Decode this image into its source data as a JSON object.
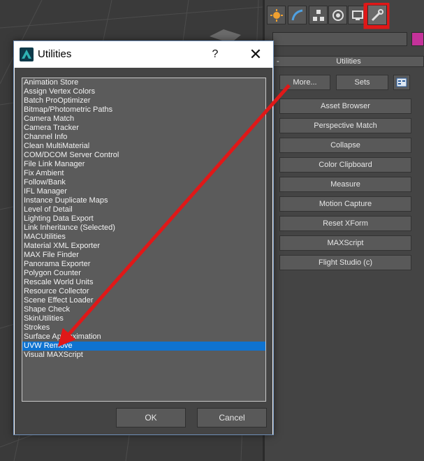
{
  "command_panel": {
    "tabs": [
      {
        "icon": "create-icon"
      },
      {
        "icon": "modify-icon"
      },
      {
        "icon": "hierarchy-icon"
      },
      {
        "icon": "motion-icon"
      },
      {
        "icon": "display-icon"
      },
      {
        "icon": "utilities-icon",
        "active": true
      }
    ],
    "swatch_color": "#c4329a",
    "rollout_title": "Utilities",
    "collapse_mark": "-",
    "more_label": "More...",
    "sets_label": "Sets",
    "buttons": [
      "Asset Browser",
      "Perspective Match",
      "Collapse",
      "Color Clipboard",
      "Measure",
      "Motion Capture",
      "Reset XForm",
      "MAXScript",
      "Flight Studio (c)"
    ]
  },
  "dialog": {
    "title": "Utilities",
    "help": "?",
    "close": "✕",
    "items": [
      "Animation Store",
      "Assign Vertex Colors",
      "Batch ProOptimizer",
      "Bitmap/Photometric Paths",
      "Camera Match",
      "Camera Tracker",
      "Channel Info",
      "Clean MultiMaterial",
      "COM/DCOM Server Control",
      "File Link Manager",
      "Fix Ambient",
      "Follow/Bank",
      "IFL Manager",
      "Instance Duplicate Maps",
      "Level of Detail",
      "Lighting Data Export",
      "Link Inheritance (Selected)",
      "MACUtilities",
      "Material XML Exporter",
      "MAX File Finder",
      "Panorama Exporter",
      "Polygon Counter",
      "Rescale World Units",
      "Resource Collector",
      "Scene Effect Loader",
      "Shape Check",
      "SkinUtilities",
      "Strokes",
      "Surface Approximation",
      "UVW Remove",
      "Visual MAXScript"
    ],
    "selected_index": 29,
    "ok_label": "OK",
    "cancel_label": "Cancel"
  },
  "colors": {
    "selection": "#0f73d0",
    "annotation": "#e01818"
  }
}
